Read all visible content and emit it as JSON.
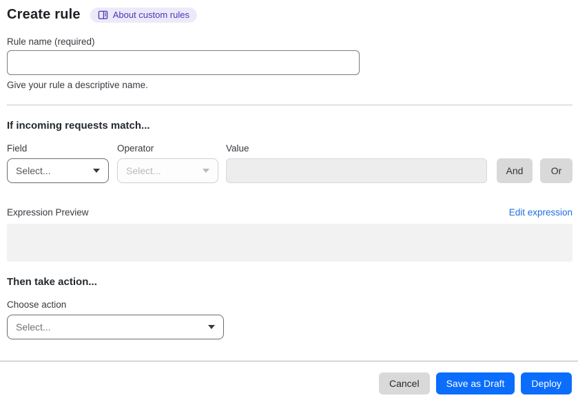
{
  "page": {
    "title": "Create rule",
    "about_badge": "About custom rules"
  },
  "rule_name": {
    "label": "Rule name (required)",
    "value": "",
    "help": "Give your rule a descriptive name."
  },
  "match_section": {
    "heading": "If incoming requests match...",
    "field_label": "Field",
    "operator_label": "Operator",
    "value_label": "Value",
    "field_value": "Select...",
    "operator_value": "Select...",
    "value_value": "",
    "and_label": "And",
    "or_label": "Or"
  },
  "expression": {
    "label": "Expression Preview",
    "edit_link": "Edit expression",
    "preview": ""
  },
  "action_section": {
    "heading": "Then take action...",
    "choose_label": "Choose action",
    "value": "Select..."
  },
  "footer": {
    "cancel": "Cancel",
    "save_draft": "Save as Draft",
    "deploy": "Deploy"
  },
  "colors": {
    "primary_blue": "#0b6dfb",
    "link_blue": "#1f6fe0",
    "badge_bg": "#eceafa",
    "badge_text": "#4338b8",
    "gray_button": "#d9d9d9"
  }
}
